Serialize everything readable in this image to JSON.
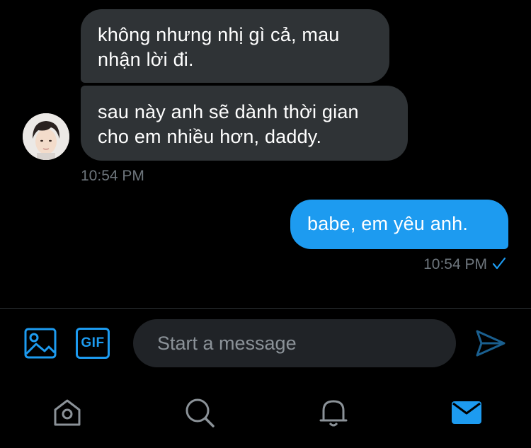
{
  "conversation": {
    "messages": [
      {
        "direction": "incoming",
        "text": "không nhưng nhị gì cả, mau nhận lời đi."
      },
      {
        "direction": "incoming",
        "text": "sau này anh sẽ dành thời gian cho em nhiều hơn, daddy."
      },
      {
        "direction": "outgoing",
        "text": "babe, em yêu anh."
      }
    ],
    "incoming_timestamp": "10:54 PM",
    "outgoing_timestamp": "10:54 PM",
    "outgoing_status_icon": "checkmark-icon"
  },
  "composer": {
    "placeholder": "Start a message",
    "value": "",
    "gif_label": "GIF",
    "image_icon": "image-icon",
    "send_icon": "send-icon"
  },
  "tab_bar": {
    "items": [
      {
        "name": "home",
        "icon": "home-icon",
        "active": false
      },
      {
        "name": "search",
        "icon": "search-icon",
        "active": false
      },
      {
        "name": "notifications",
        "icon": "bell-icon",
        "active": false
      },
      {
        "name": "messages",
        "icon": "envelope-icon",
        "active": true
      }
    ]
  },
  "colors": {
    "background": "#000000",
    "incoming_bubble": "#2f3336",
    "outgoing_bubble": "#1d9bf0",
    "accent": "#1d9bf0",
    "muted_text": "#6e767d",
    "inactive_icon": "#8b9298"
  }
}
